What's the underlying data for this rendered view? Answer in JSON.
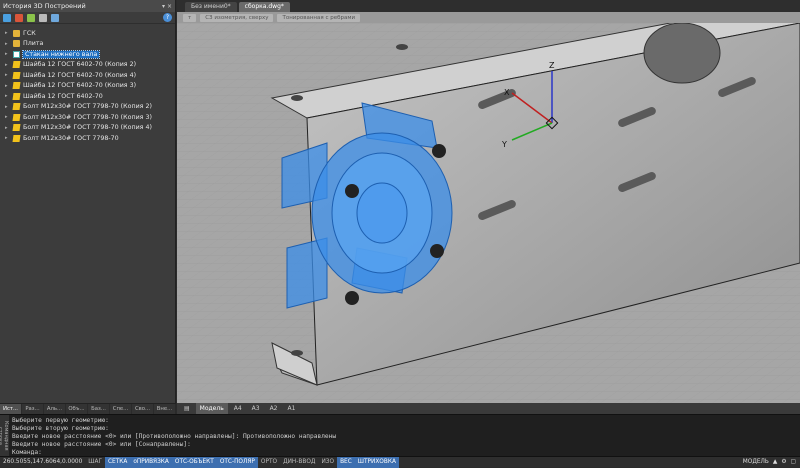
{
  "panel": {
    "title": "История 3D Построений",
    "pin": "▾ ×",
    "tree": [
      {
        "label": "ГСК",
        "icon": "folder"
      },
      {
        "label": "Плита",
        "icon": "folder"
      },
      {
        "label": "Стакан нижнего вала",
        "icon": "selected",
        "selected": true
      },
      {
        "label": "Шайба 12 ГОСТ 6402-70 (Копия 2)",
        "icon": "part"
      },
      {
        "label": "Шайба 12 ГОСТ 6402-70 (Копия 4)",
        "icon": "part"
      },
      {
        "label": "Шайба 12 ГОСТ 6402-70 (Копия 3)",
        "icon": "part"
      },
      {
        "label": "Шайба 12 ГОСТ 6402-70",
        "icon": "part"
      },
      {
        "label": "Болт М12х30# ГОСТ 7798-70 (Копия 2)",
        "icon": "part"
      },
      {
        "label": "Болт М12х30# ГОСТ 7798-70 (Копия 3)",
        "icon": "part"
      },
      {
        "label": "Болт М12х30# ГОСТ 7798-70 (Копия 4)",
        "icon": "part"
      },
      {
        "label": "Болт М12х30# ГОСТ 7798-70",
        "icon": "part"
      }
    ],
    "tabs": [
      "Ист...",
      "Раз...",
      "Аль...",
      "Объ...",
      "Баз...",
      "Спе...",
      "Сво...",
      "Вне..."
    ]
  },
  "doc_tabs": [
    "Без имени0*",
    "сборка.dwg*"
  ],
  "breadcrumbs": [
    "т",
    "СЗ изометрия, сверху",
    "Тонированная с ребрами"
  ],
  "layout_tabs": [
    "Модель",
    "A4",
    "A3",
    "A2",
    "A1"
  ],
  "command": {
    "side_label": "Командная строка",
    "lines": [
      "Выберите первую геометрию:",
      "Выберите вторую геометрию:",
      "Введите новое расстояние <0> или [Противоположно направлены]: Противоположно направлены",
      "Введите новое расстояние <0> или [Сонаправлены]:",
      "Команда:"
    ]
  },
  "status": {
    "coords": "260.5055,147.6064,0.0000",
    "toggles": [
      {
        "label": "ШАГ",
        "on": false
      },
      {
        "label": "СЕТКА",
        "on": true
      },
      {
        "label": "оПРИВЯЗКА",
        "on": true
      },
      {
        "label": "ОТС-ОБЪЕКТ",
        "on": true
      },
      {
        "label": "ОТС-ПОЛЯР",
        "on": true
      },
      {
        "label": "ОРТО",
        "on": false
      },
      {
        "label": "ДИН-ВВОД",
        "on": false
      },
      {
        "label": "ИЗО",
        "on": false
      },
      {
        "label": "ВЕС",
        "on": true
      },
      {
        "label": "ШТРИХОВКА",
        "on": true
      }
    ],
    "mode": "МОДЕЛЬ"
  },
  "colors": {
    "accent": "#1f6fc0",
    "viewport_bg": "#a6a6a6",
    "selection_blue": "#3b8ee8"
  }
}
